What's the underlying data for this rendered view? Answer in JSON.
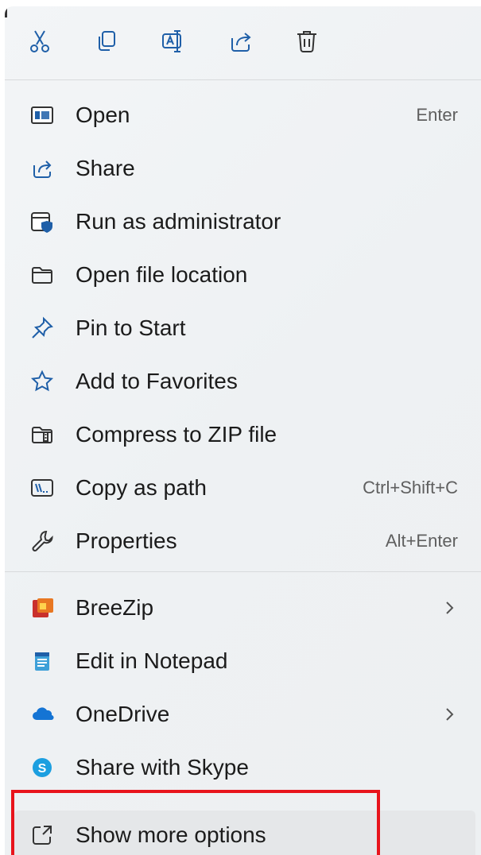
{
  "toolbar": {
    "icons": [
      "cut-icon",
      "copy-icon",
      "rename-icon",
      "share-icon",
      "delete-icon"
    ]
  },
  "items": [
    {
      "label": "Open",
      "shortcut": "Enter",
      "icon": "open-app-icon"
    },
    {
      "label": "Share",
      "icon": "share-icon"
    },
    {
      "label": "Run as administrator",
      "icon": "admin-shield-icon"
    },
    {
      "label": "Open file location",
      "icon": "folder-icon"
    },
    {
      "label": "Pin to Start",
      "icon": "pin-icon"
    },
    {
      "label": "Add to Favorites",
      "icon": "star-icon"
    },
    {
      "label": "Compress to ZIP file",
      "icon": "zip-folder-icon"
    },
    {
      "label": "Copy as path",
      "shortcut": "Ctrl+Shift+C",
      "icon": "copy-path-icon"
    },
    {
      "label": "Properties",
      "shortcut": "Alt+Enter",
      "icon": "wrench-icon"
    },
    {
      "label": "BreeZip",
      "submenu": true,
      "icon": "breezip-icon"
    },
    {
      "label": "Edit in Notepad",
      "icon": "notepad-icon"
    },
    {
      "label": "OneDrive",
      "submenu": true,
      "icon": "onedrive-cloud-icon"
    },
    {
      "label": "Share with Skype",
      "icon": "skype-icon"
    },
    {
      "label": "Show more options",
      "icon": "show-more-icon"
    }
  ],
  "colors": {
    "accent": "#0067c0",
    "highlight_box": "#e8141c",
    "menu_bg": "#eef1f3"
  }
}
